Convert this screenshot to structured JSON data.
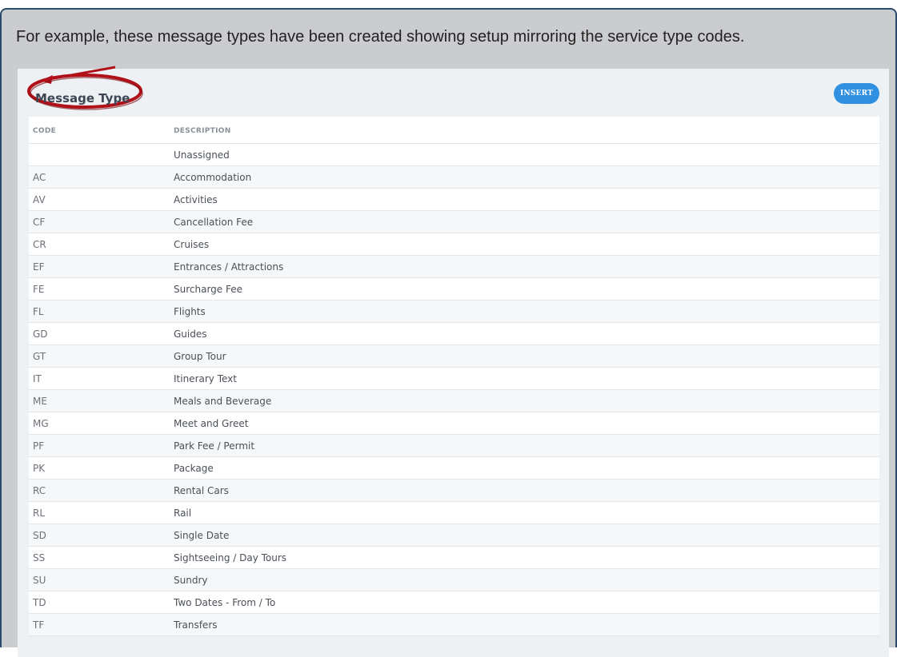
{
  "caption": "For example, these message types have been created showing setup mirroring the service type codes.",
  "panel": {
    "title": "Message Type",
    "insert_label": "INSERT"
  },
  "table": {
    "headers": {
      "code": "CODE",
      "description": "DESCRIPTION"
    },
    "rows": [
      {
        "code": "",
        "description": "Unassigned"
      },
      {
        "code": "AC",
        "description": "Accommodation"
      },
      {
        "code": "AV",
        "description": "Activities"
      },
      {
        "code": "CF",
        "description": "Cancellation Fee"
      },
      {
        "code": "CR",
        "description": "Cruises"
      },
      {
        "code": "EF",
        "description": "Entrances / Attractions"
      },
      {
        "code": "FE",
        "description": "Surcharge Fee"
      },
      {
        "code": "FL",
        "description": "Flights"
      },
      {
        "code": "GD",
        "description": "Guides"
      },
      {
        "code": "GT",
        "description": "Group Tour"
      },
      {
        "code": "IT",
        "description": "Itinerary Text"
      },
      {
        "code": "ME",
        "description": "Meals and Beverage"
      },
      {
        "code": "MG",
        "description": "Meet and Greet"
      },
      {
        "code": "PF",
        "description": "Park Fee / Permit"
      },
      {
        "code": "PK",
        "description": "Package"
      },
      {
        "code": "RC",
        "description": "Rental Cars"
      },
      {
        "code": "RL",
        "description": "Rail"
      },
      {
        "code": "SD",
        "description": "Single Date"
      },
      {
        "code": "SS",
        "description": "Sightseeing / Day Tours"
      },
      {
        "code": "SU",
        "description": "Sundry"
      },
      {
        "code": "TD",
        "description": "Two Dates - From / To"
      },
      {
        "code": "TF",
        "description": "Transfers"
      }
    ]
  },
  "colors": {
    "accent": "#2f8fe0",
    "highlight": "#b01018",
    "frame_border": "#2c4a6b"
  }
}
